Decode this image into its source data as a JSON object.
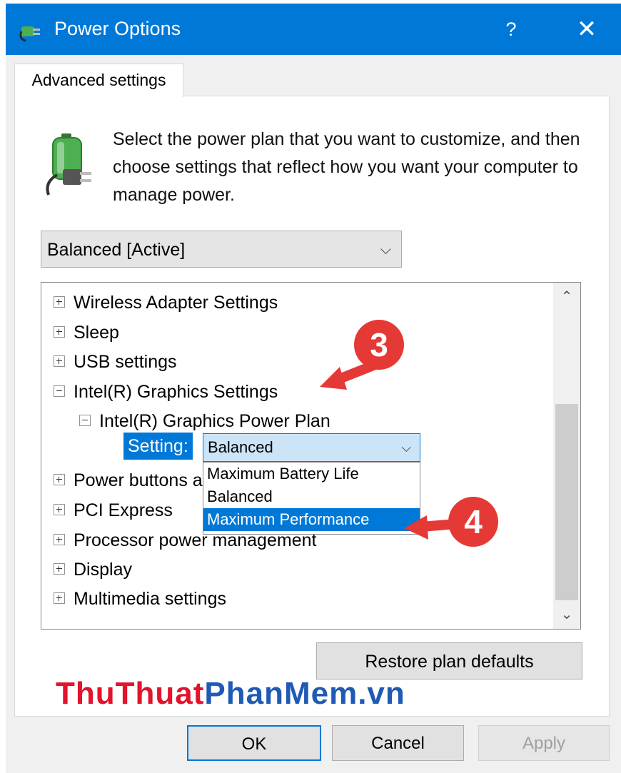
{
  "window": {
    "title": "Power Options",
    "help_label": "?",
    "close_label": "✕"
  },
  "tab": {
    "label": "Advanced settings"
  },
  "description": "Select the power plan that you want to customize, and then choose settings that reflect how you want your computer to manage power.",
  "plan_select": {
    "value": "Balanced [Active]"
  },
  "tree": {
    "items": [
      {
        "label": "Wireless Adapter Settings",
        "expanded": false
      },
      {
        "label": "Sleep",
        "expanded": false
      },
      {
        "label": "USB settings",
        "expanded": false
      },
      {
        "label": "Intel(R) Graphics Settings",
        "expanded": true
      },
      {
        "label": "Intel(R) Graphics Power Plan",
        "expanded": true
      },
      {
        "label": "Power buttons and lid",
        "expanded": false
      },
      {
        "label": "PCI Express",
        "expanded": false
      },
      {
        "label": "Processor power management",
        "expanded": false
      },
      {
        "label": "Display",
        "expanded": false
      },
      {
        "label": "Multimedia settings",
        "expanded": false
      }
    ],
    "setting_label": "Setting:",
    "setting_value": "Balanced",
    "dropdown_options": [
      {
        "label": "Maximum Battery Life",
        "selected": false
      },
      {
        "label": "Balanced",
        "selected": false
      },
      {
        "label": "Maximum Performance",
        "selected": true
      }
    ]
  },
  "buttons": {
    "restore": "Restore plan defaults",
    "ok": "OK",
    "cancel": "Cancel",
    "apply": "Apply"
  },
  "watermark": {
    "part1": "ThuThuat",
    "part2": "PhanMem.vn"
  },
  "callouts": {
    "step3": "3",
    "step4": "4"
  },
  "colors": {
    "accent": "#0078d7",
    "callout": "#e53935",
    "watermark_red": "#e3132c",
    "watermark_blue": "#1f5ab4"
  }
}
